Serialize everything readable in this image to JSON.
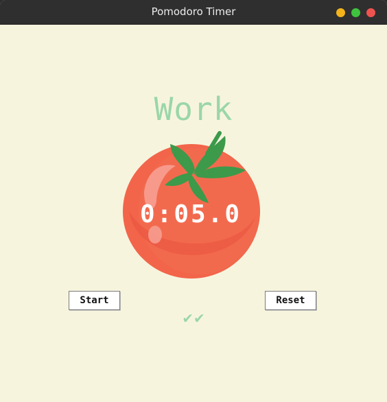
{
  "window": {
    "title": "Pomodoro Timer"
  },
  "colors": {
    "background": "#f7f4de",
    "accent": "#9bd6a8",
    "tomato": "#f2654a",
    "leaf": "#3c9a4a"
  },
  "timer": {
    "heading": "Work",
    "display": "0:05.0",
    "start_label": "Start",
    "reset_label": "Reset",
    "checkmarks": "✔✔"
  }
}
